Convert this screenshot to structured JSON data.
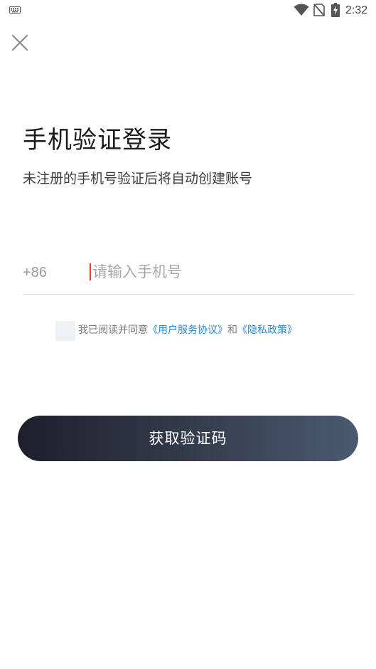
{
  "status_bar": {
    "time": "2:32",
    "icons": [
      "keyboard-icon",
      "wifi-icon",
      "no-sim-icon",
      "battery-charging-icon"
    ]
  },
  "close_icon": "close-icon",
  "title": "手机验证登录",
  "subtitle": "未注册的手机号验证后将自动创建账号",
  "phone": {
    "country_code": "+86",
    "placeholder": "请输入手机号",
    "value": ""
  },
  "agreement": {
    "checked": false,
    "prefix": "我已阅读并同意",
    "user_agreement": "《用户服务协议》",
    "and": "和",
    "privacy_policy": "《隐私政策》"
  },
  "submit": {
    "label": "获取验证码"
  },
  "colors": {
    "link": "#1e88e5",
    "caret": "#e2452f",
    "button_gradient_start": "#1e1f2c",
    "button_gradient_end": "#4a5a70",
    "checkbox_bg": "#eef0f3"
  }
}
